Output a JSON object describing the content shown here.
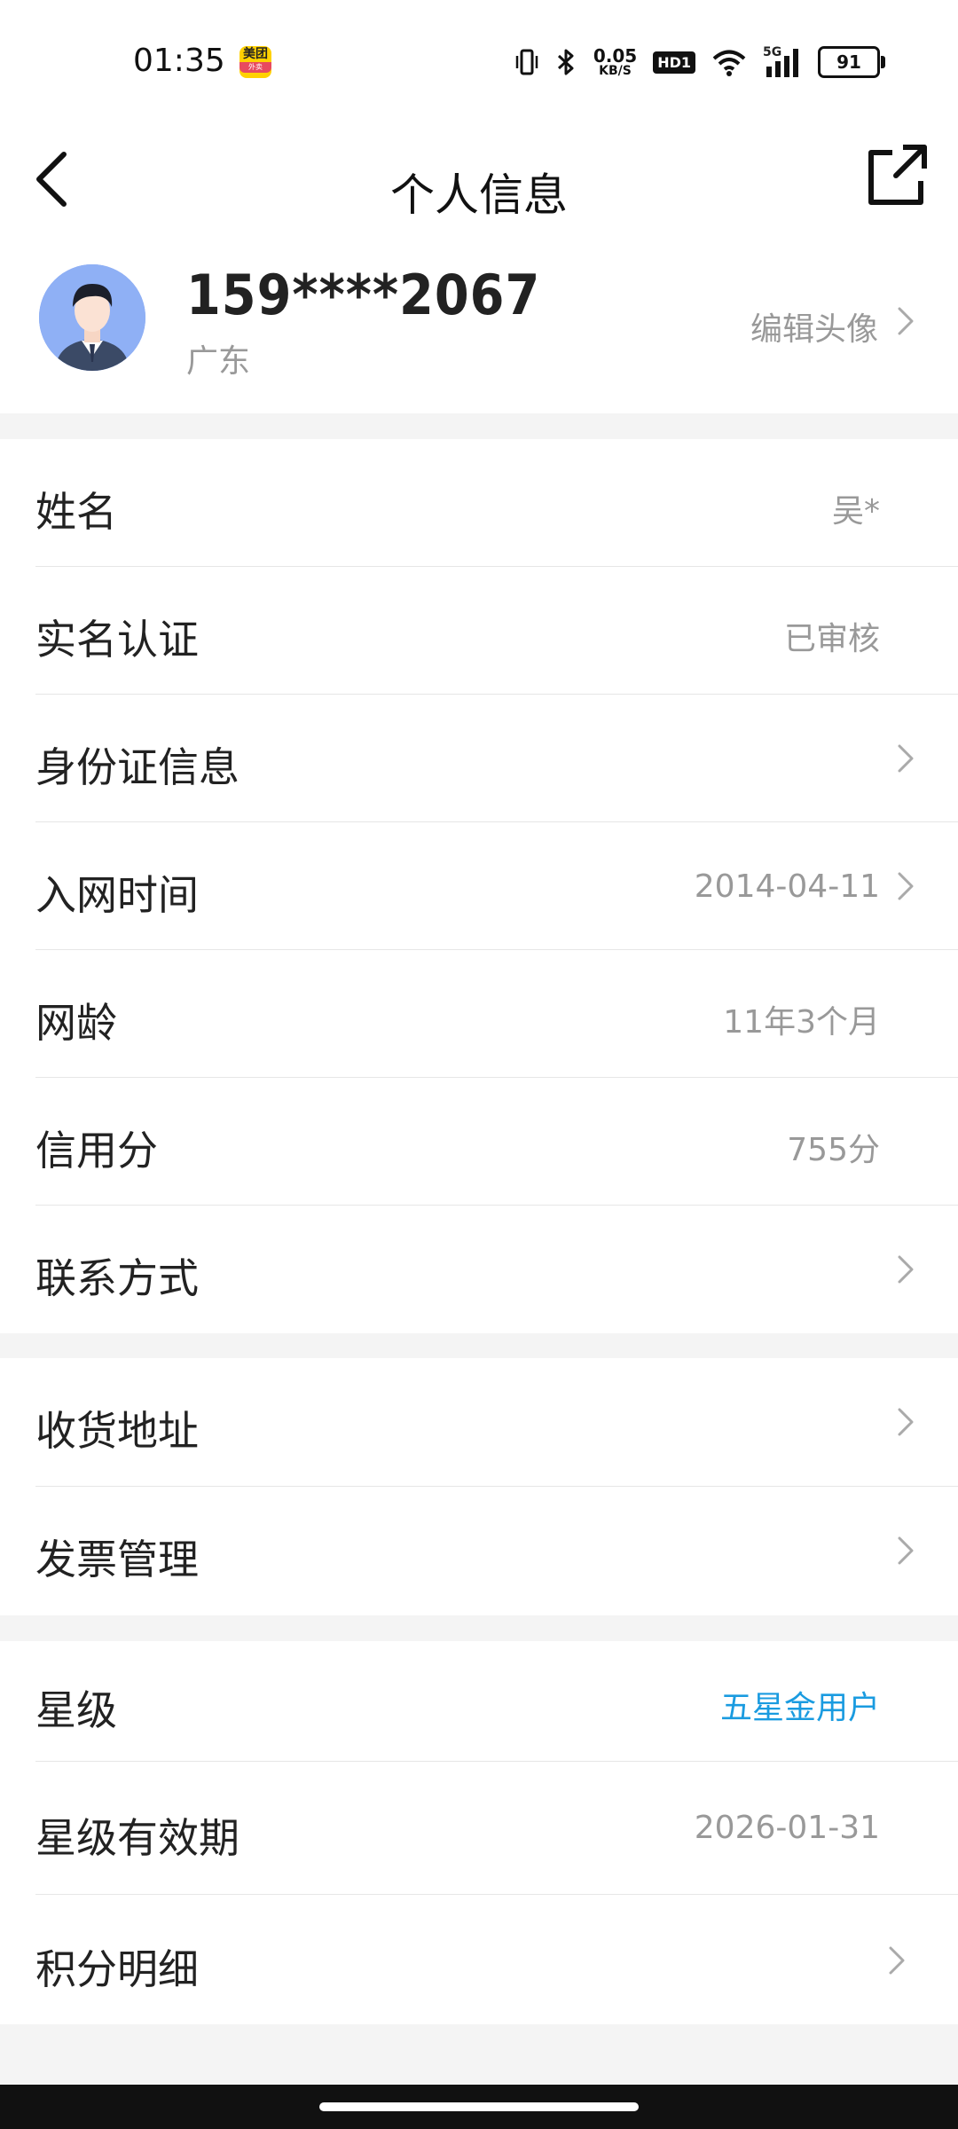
{
  "status_bar": {
    "time": "01:35",
    "app_icon_text": "美团",
    "app_icon_sub": "外卖",
    "net_speed_value": "0.05",
    "net_speed_unit": "KB/S",
    "hd_label": "HD1",
    "signal_label": "5G",
    "battery_level": "91",
    "icons": [
      "vibrate-icon",
      "bluetooth-icon",
      "wifi-icon",
      "signal-icon",
      "battery-icon"
    ]
  },
  "nav": {
    "title": "个人信息",
    "back_icon": "back-arrow-icon",
    "share_icon": "share-external-icon"
  },
  "profile": {
    "phone": "159****2067",
    "region": "广东",
    "edit_label": "编辑头像"
  },
  "groups": [
    {
      "rows": [
        {
          "label": "姓名",
          "value": "吴*",
          "chevron": false
        },
        {
          "label": "实名认证",
          "value": "已审核",
          "chevron": false
        },
        {
          "label": "身份证信息",
          "value": "",
          "chevron": true
        },
        {
          "label": "入网时间",
          "value": "2014-04-11",
          "chevron": true
        },
        {
          "label": "网龄",
          "value": "11年3个月",
          "chevron": false
        },
        {
          "label": "信用分",
          "value": "755分",
          "chevron": false
        },
        {
          "label": "联系方式",
          "value": "",
          "chevron": true
        }
      ]
    },
    {
      "rows": [
        {
          "label": "收货地址",
          "value": "",
          "chevron": true
        },
        {
          "label": "发票管理",
          "value": "",
          "chevron": true
        }
      ]
    },
    {
      "rows": [
        {
          "label": "星级",
          "value": "五星金用户",
          "chevron": false
        },
        {
          "label": "星级有效期",
          "value": "2026-01-31",
          "chevron": false
        },
        {
          "label": "积分明细",
          "value": "",
          "chevron": true
        }
      ]
    }
  ],
  "colors": {
    "accent_blue": "#1a9be0",
    "secondary_text": "#999999",
    "primary_text": "#222222",
    "page_bg": "#f4f4f4"
  }
}
